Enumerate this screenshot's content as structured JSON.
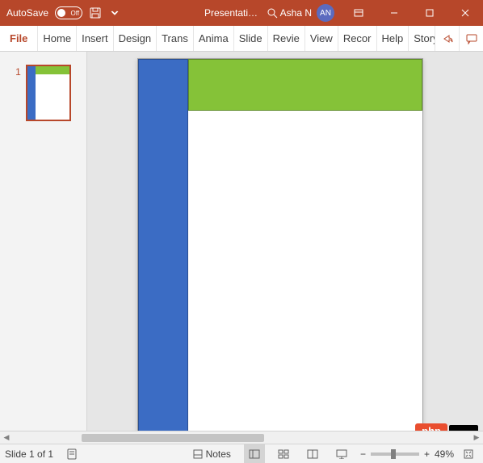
{
  "titlebar": {
    "autosave_label": "AutoSave",
    "autosave_state": "Off",
    "document_title": "Presentati…",
    "user_name": "Asha N",
    "user_initials": "AN"
  },
  "ribbon": {
    "tabs": [
      "File",
      "Home",
      "Insert",
      "Design",
      "Trans",
      "Anima",
      "Slide",
      "Revie",
      "View",
      "Recor",
      "Help",
      "Storyl"
    ]
  },
  "thumbnails": {
    "slide_number": "1"
  },
  "statusbar": {
    "slide_indicator": "Slide 1 of 1",
    "notes_label": "Notes",
    "zoom_label": "49%"
  },
  "overlay": {
    "badge": "php"
  },
  "colors": {
    "accent": "#b7472a",
    "blue_shape": "#3b6cc4",
    "green_shape": "#85c238"
  }
}
